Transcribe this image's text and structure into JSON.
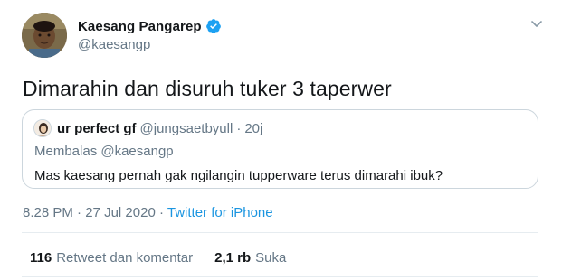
{
  "author": {
    "name": "Kaesang Pangarep",
    "handle": "@kaesangp",
    "verified_color": "#1da1f2"
  },
  "tweet": {
    "text": "Dimarahin dan disuruh tuker 3 taperwer"
  },
  "quoted": {
    "name": "ur perfect gf",
    "handle": "@jungsaetbyull",
    "dot": "·",
    "time": "20j",
    "reply_to": "Membalas @kaesangp",
    "text": "Mas kaesang pernah gak ngilangin tupperware terus dimarahi ibuk?"
  },
  "meta": {
    "time": "8.28 PM",
    "sep1": "·",
    "date": "27 Jul 2020",
    "sep2": "·",
    "source": "Twitter for iPhone"
  },
  "stats": {
    "retweets_count": "116",
    "retweets_label": "Retweet dan komentar",
    "likes_count": "2,1 rb",
    "likes_label": "Suka"
  },
  "icons": {
    "verified": "verified-badge-icon",
    "more": "chevron-down-icon"
  }
}
